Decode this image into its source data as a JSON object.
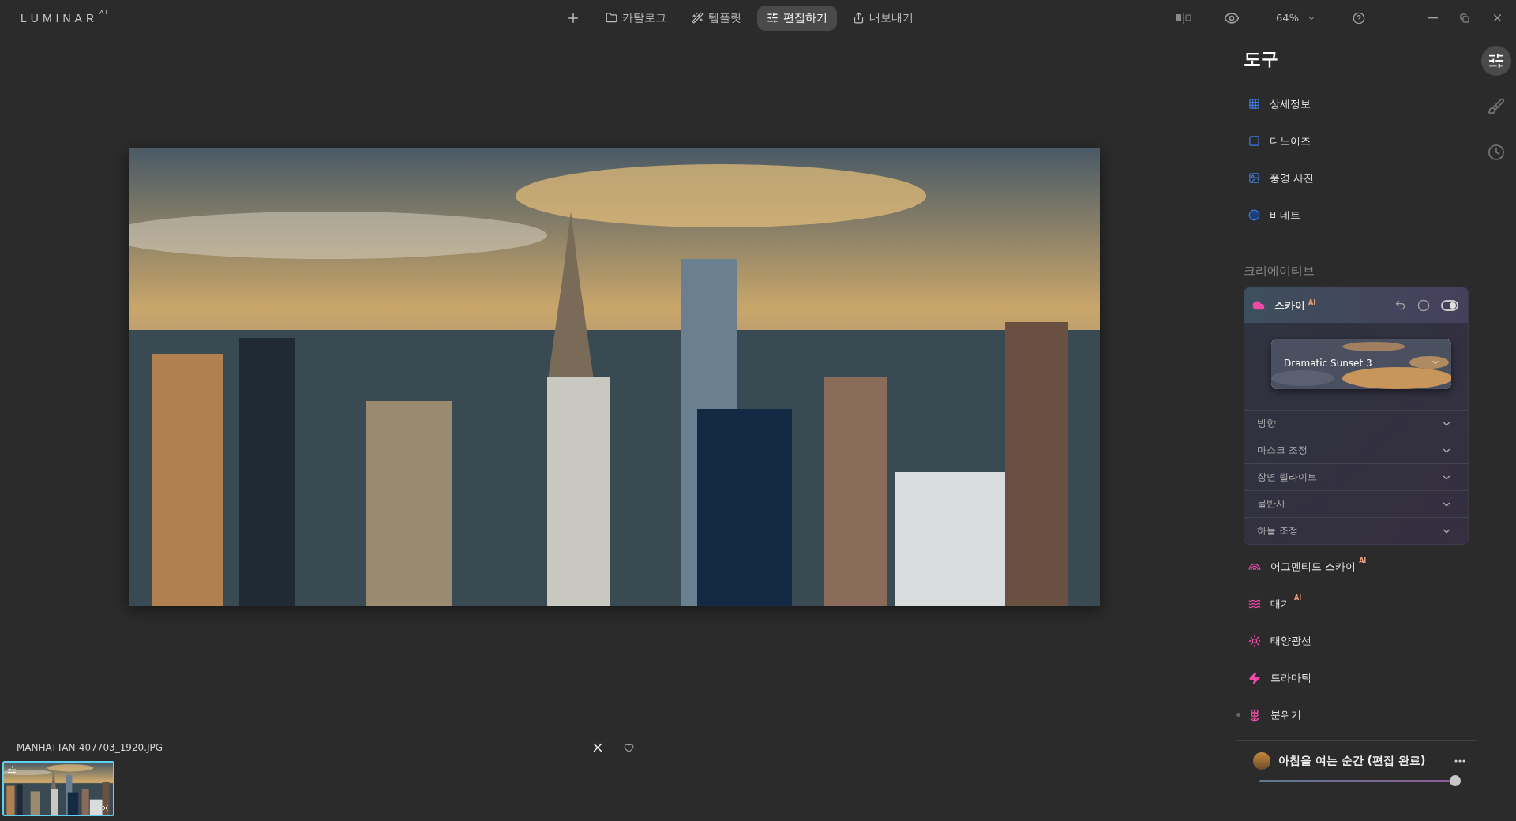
{
  "app": {
    "logo": "LUMINAR",
    "logo_sup": "AI"
  },
  "nav": [
    {
      "kind": "add",
      "selected": false
    },
    {
      "kind": "catalog",
      "label": "카탈로그",
      "selected": false
    },
    {
      "kind": "templates",
      "label": "템플릿",
      "selected": false
    },
    {
      "kind": "edit",
      "label": "편집하기",
      "selected": true
    },
    {
      "kind": "export",
      "label": "내보내기",
      "selected": false
    }
  ],
  "view": {
    "zoom": "64%"
  },
  "tools_panel": {
    "title": "도구",
    "essentials": [
      {
        "label": "상세정보",
        "kind": "detail"
      },
      {
        "label": "디노이즈",
        "kind": "denoise"
      },
      {
        "label": "풍경 사진"
      },
      {
        "label": "비네트",
        "kind": "vignette"
      }
    ],
    "creative_heading": "크리에이티브",
    "sky": {
      "label": "스카이",
      "badge": "AI",
      "enabled": true,
      "preset": "Dramatic Sunset 3",
      "sections": [
        {
          "label": "방향",
          "expanded": false
        },
        {
          "label": "마스크 조정",
          "expanded": false
        },
        {
          "label": "장면 릴라이트",
          "expanded": false
        },
        {
          "label": "물반사",
          "expanded": false
        },
        {
          "label": "하늘 조정",
          "expanded": false
        }
      ]
    },
    "creative_items": [
      {
        "label": "어그멘티드 스카이",
        "badge": "AI",
        "kind": "rainbow",
        "modified": false
      },
      {
        "label": "대기",
        "badge": "AI",
        "kind": "waves",
        "modified": false
      },
      {
        "label": "태양광선",
        "kind": "sun",
        "modified": false
      },
      {
        "label": "드라마틱",
        "kind": "bolt",
        "modified": false
      },
      {
        "label": "분위기",
        "kind": "lotus",
        "modified": true
      }
    ]
  },
  "rail": [
    {
      "kind": "tools",
      "selected": true
    },
    {
      "kind": "brush",
      "selected": false
    },
    {
      "kind": "history",
      "selected": false
    }
  ],
  "template": {
    "name": "아침을 여는 순간 (편집 완료)",
    "level": 0.98
  },
  "filmstrip": {
    "filename": "MANHATTAN-407703_1920.JPG",
    "thumbnails": [
      {
        "selected": true,
        "edited": true
      }
    ]
  }
}
